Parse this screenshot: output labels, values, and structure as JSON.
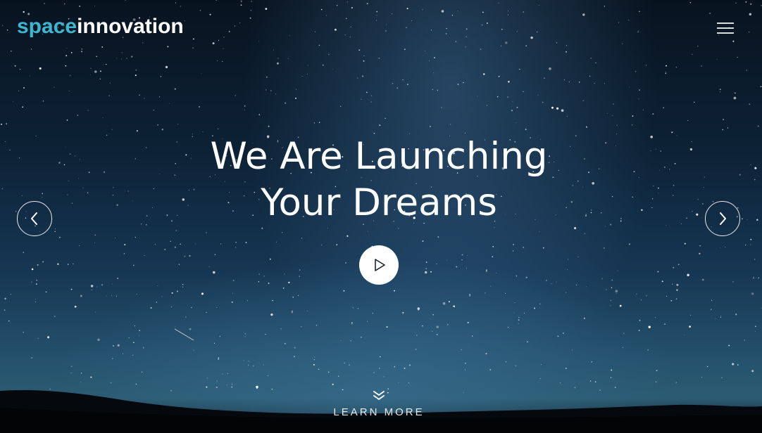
{
  "brand": {
    "logo_part1": "space",
    "logo_part2": "innovation",
    "color_part1": "#3fb6cf",
    "color_part2": "#ffffff"
  },
  "header": {
    "menu_icon": "hamburger-menu-icon"
  },
  "hero": {
    "headline_line1": "We Are Launching",
    "headline_line2": "Your Dreams",
    "prev_icon": "chevron-left-icon",
    "next_icon": "chevron-right-icon",
    "play_icon": "play-icon"
  },
  "footer": {
    "learn_more_label": "LEARN MORE",
    "learn_more_icon": "double-chevron-down-icon"
  }
}
